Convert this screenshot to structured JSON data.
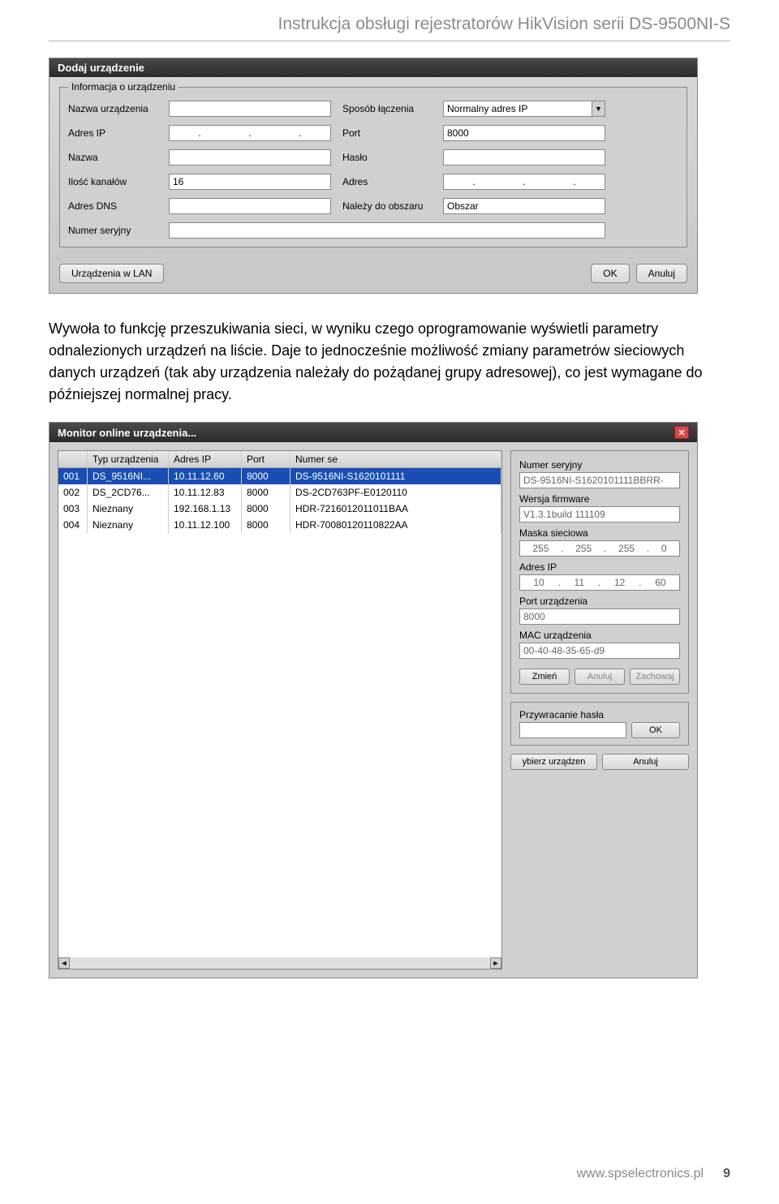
{
  "header": {
    "title": "Instrukcja obsługi rejestratorów HikVision serii DS-9500NI-S"
  },
  "dialog1": {
    "title": "Dodaj urządzenie",
    "groupLabel": "Informacja o urządzeniu",
    "labels": {
      "deviceName": "Nazwa urządzenia",
      "connMethod": "Sposób łączenia",
      "ip": "Adres IP",
      "port": "Port",
      "name": "Nazwa",
      "password": "Hasło",
      "channels": "Ilość kanałów",
      "address": "Adres",
      "dns": "Adres DNS",
      "area": "Należy do obszaru",
      "serial": "Numer seryjny"
    },
    "values": {
      "connMethod": "Normalny adres IP",
      "port": "8000",
      "channels": "16",
      "area": "Obszar"
    },
    "buttons": {
      "lan": "Urządzenia w LAN",
      "ok": "OK",
      "cancel": "Anuluj"
    }
  },
  "paragraph": "Wywoła to funkcję przeszukiwania sieci, w wyniku czego oprogramowanie wyświetli parametry odnalezionych urządzeń na liście. Daje to jednocześnie możliwość zmiany parametrów sieciowych danych urządzeń (tak aby urządzenia należały do pożądanej grupy adresowej), co jest wymagane do późniejszej normalnej pracy.",
  "dialog2": {
    "title": "Monitor online urządzenia...",
    "columns": [
      "",
      "Typ urządzenia",
      "Adres IP",
      "Port",
      "Numer se"
    ],
    "rows": [
      {
        "idx": "001",
        "type": "DS_9516NI...",
        "ip": "10.11.12.60",
        "port": "8000",
        "serial": "DS-9516NI-S1620101111"
      },
      {
        "idx": "002",
        "type": "DS_2CD76...",
        "ip": "10.11.12.83",
        "port": "8000",
        "serial": "DS-2CD763PF-E0120110"
      },
      {
        "idx": "003",
        "type": "Nieznany",
        "ip": "192.168.1.13",
        "port": "8000",
        "serial": "HDR-7216012011011BAA"
      },
      {
        "idx": "004",
        "type": "Nieznany",
        "ip": "10.11.12.100",
        "port": "8000",
        "serial": "HDR-70080120110822AA"
      }
    ],
    "side": {
      "serialLabel": "Numer seryjny",
      "serialValue": "DS-9516NI-S1620101111BBRR-",
      "firmwareLabel": "Wersja firmware",
      "firmwareValue": "V1.3.1build 111109",
      "maskLabel": "Maska sieciowa",
      "mask": [
        "255",
        "255",
        "255",
        "0"
      ],
      "ipLabel": "Adres IP",
      "ip": [
        "10",
        "11",
        "12",
        "60"
      ],
      "portLabel": "Port urządzenia",
      "portValue": "8000",
      "macLabel": "MAC urządzenia",
      "macValue": "00-40-48-35-65-d9",
      "btnChange": "Zmień",
      "btnCancel": "Anuluj",
      "btnSave": "Zachowaj",
      "resetLabel": "Przywracanie hasła",
      "btnOk": "OK",
      "btnSelect": "ybierz urządzen",
      "btnCancel2": "Anuluj"
    }
  },
  "footer": {
    "url": "www.spselectronics.pl",
    "page": "9"
  }
}
